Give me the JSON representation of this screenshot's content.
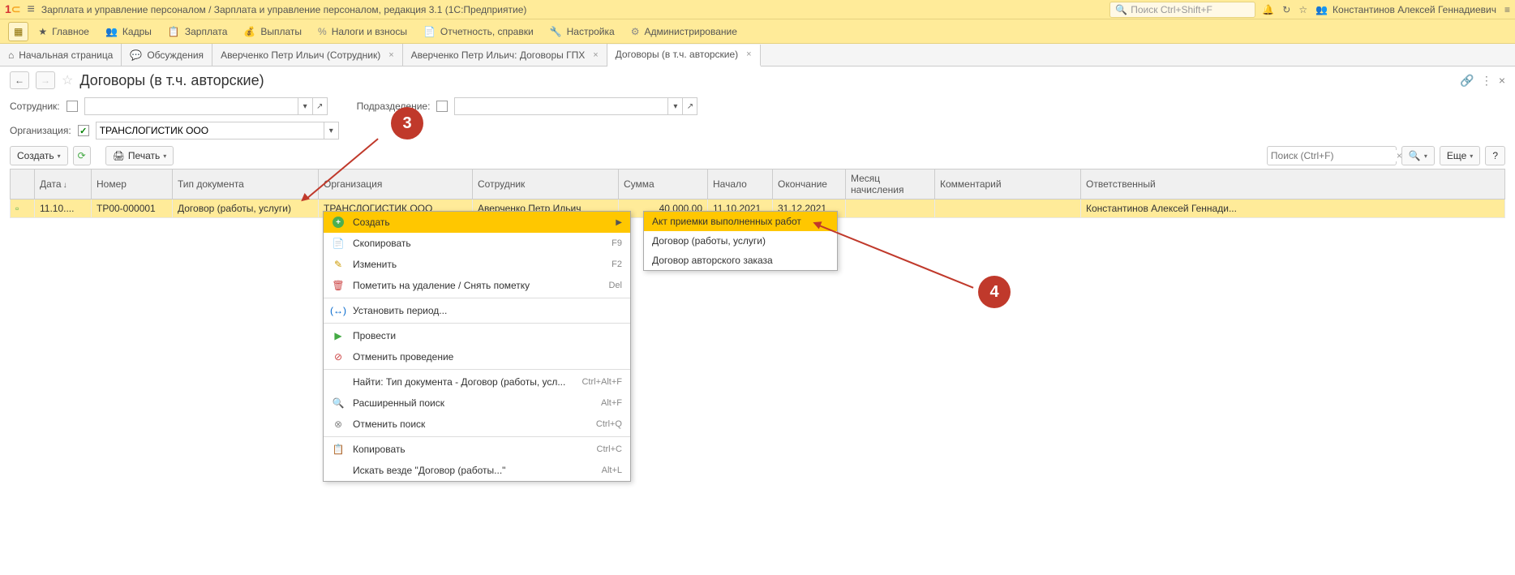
{
  "titleBar": {
    "title": "Зарплата и управление персоналом / Зарплата и управление персоналом, редакция 3.1  (1С:Предприятие)",
    "searchPlaceholder": "Поиск Ctrl+Shift+F",
    "userName": "Константинов Алексей Геннадиевич"
  },
  "mainMenu": [
    {
      "label": "Главное"
    },
    {
      "label": "Кадры"
    },
    {
      "label": "Зарплата"
    },
    {
      "label": "Выплаты"
    },
    {
      "label": "Налоги и взносы"
    },
    {
      "label": "Отчетность, справки"
    },
    {
      "label": "Настройка"
    },
    {
      "label": "Администрирование"
    }
  ],
  "tabs": [
    {
      "label": "Начальная страница",
      "closable": false
    },
    {
      "label": "Обсуждения",
      "closable": false
    },
    {
      "label": "Аверченко Петр Ильич (Сотрудник)",
      "closable": true
    },
    {
      "label": "Аверченко Петр Ильич: Договоры ГПХ",
      "closable": true
    },
    {
      "label": "Договоры (в т.ч. авторские)",
      "closable": true,
      "active": true
    }
  ],
  "page": {
    "title": "Договоры (в т.ч. авторские)"
  },
  "filters": {
    "employeeLabel": "Сотрудник:",
    "subdivLabel": "Подразделение:",
    "orgLabel": "Организация:",
    "orgValue": "ТРАНСЛОГИСТИК ООО"
  },
  "toolbar": {
    "createLabel": "Создать",
    "printLabel": "Печать",
    "searchPlaceholder": "Поиск (Ctrl+F)",
    "moreLabel": "Еще"
  },
  "table": {
    "columns": [
      "",
      "Дата",
      "Номер",
      "Тип документа",
      "Организация",
      "Сотрудник",
      "Сумма",
      "Начало",
      "Окончание",
      "Месяц начисления",
      "Комментарий",
      "Ответственный"
    ],
    "rows": [
      {
        "date": "11.10....",
        "number": "ТР00-000001",
        "docType": "Договор (работы, услуги)",
        "org": "ТРАНСЛОГИСТИК ООО",
        "employee": "Аверченко Петр Ильич",
        "sum": "40 000,00",
        "start": "11.10.2021",
        "end": "31.12.2021",
        "month": "",
        "comment": "",
        "responsible": "Константинов Алексей Геннади..."
      }
    ]
  },
  "contextMenu": [
    {
      "label": "Создать",
      "highlighted": true,
      "hasSubmenu": true,
      "iconColor": "green-plus"
    },
    {
      "label": "Скопировать",
      "shortcut": "F9",
      "icon": "copy"
    },
    {
      "label": "Изменить",
      "shortcut": "F2",
      "icon": "edit"
    },
    {
      "label": "Пометить на удаление / Снять пометку",
      "shortcut": "Del",
      "icon": "delete"
    },
    {
      "sep": true
    },
    {
      "label": "Установить период...",
      "icon": "period"
    },
    {
      "sep": true
    },
    {
      "label": "Провести",
      "icon": "conduct"
    },
    {
      "label": "Отменить проведение",
      "icon": "cancel-conduct"
    },
    {
      "sep": true
    },
    {
      "label": "Найти: Тип документа - Договор (работы, усл...",
      "shortcut": "Ctrl+Alt+F"
    },
    {
      "label": "Расширенный поиск",
      "shortcut": "Alt+F",
      "icon": "search"
    },
    {
      "label": "Отменить поиск",
      "shortcut": "Ctrl+Q",
      "icon": "cancel-search"
    },
    {
      "sep": true
    },
    {
      "label": "Копировать",
      "shortcut": "Ctrl+C",
      "icon": "clipboard"
    },
    {
      "label": "Искать везде \"Договор (работы...\"",
      "shortcut": "Alt+L"
    }
  ],
  "submenu": [
    {
      "label": "Акт приемки выполненных работ",
      "highlighted": true
    },
    {
      "label": "Договор (работы, услуги)"
    },
    {
      "label": "Договор авторского заказа"
    }
  ],
  "annotations": {
    "badge3": "3",
    "badge4": "4"
  }
}
